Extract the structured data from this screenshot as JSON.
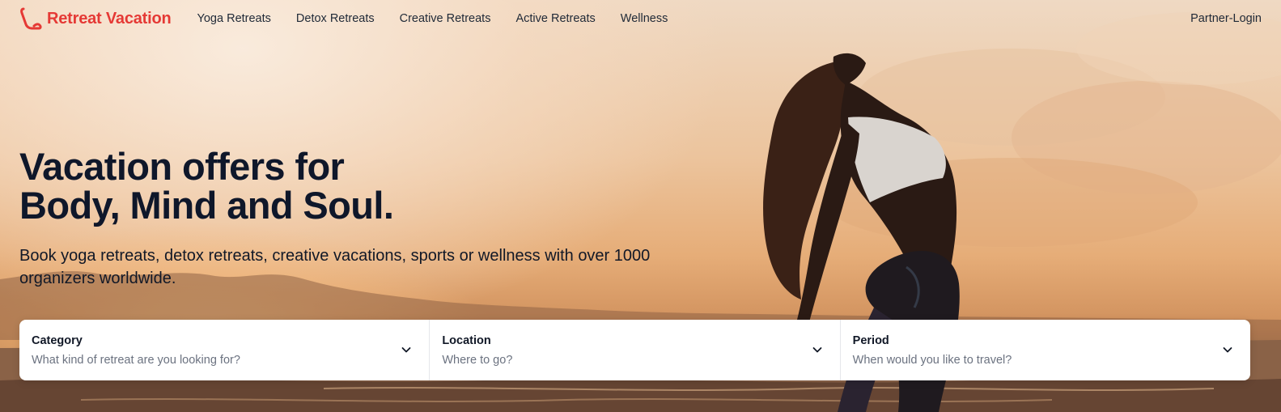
{
  "brand": {
    "name": "Retreat Vacation",
    "color": "#e53935",
    "icon": "retreat-logo-icon"
  },
  "nav": {
    "links": [
      {
        "label": "Yoga Retreats"
      },
      {
        "label": "Detox Retreats"
      },
      {
        "label": "Creative Retreats"
      },
      {
        "label": "Active Retreats"
      },
      {
        "label": "Wellness"
      }
    ],
    "partner_login": "Partner-Login"
  },
  "hero": {
    "title_line1": "Vacation offers for",
    "title_line2": "Body, Mind and Soul.",
    "subtitle": "Book yoga retreats, detox retreats, creative vacations, sports or wellness with over 1000 organizers worldwide.",
    "image": "sunset-beach-yoga-photo"
  },
  "search": {
    "fields": [
      {
        "label": "Category",
        "placeholder": "What kind of retreat are you looking for?",
        "icon": "chevron-down-icon"
      },
      {
        "label": "Location",
        "placeholder": "Where to go?",
        "icon": "chevron-down-icon"
      },
      {
        "label": "Period",
        "placeholder": "When would you like to travel?",
        "icon": "chevron-down-icon"
      }
    ]
  }
}
